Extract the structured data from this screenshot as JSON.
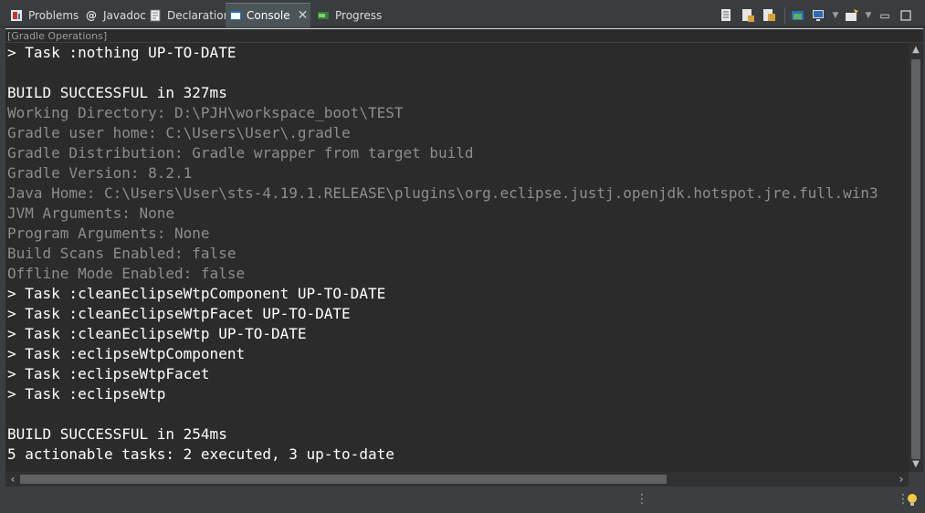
{
  "tabs": [
    {
      "label": "Problems",
      "icon": "problems-icon",
      "active": false
    },
    {
      "label": "Javadoc",
      "icon": "javadoc-icon",
      "active": false
    },
    {
      "label": "Declaration",
      "icon": "declaration-icon",
      "active": false
    },
    {
      "label": "Console",
      "icon": "console-icon",
      "active": true
    },
    {
      "label": "Progress",
      "icon": "progress-icon",
      "active": false
    }
  ],
  "console": {
    "name": "[Gradle Operations]",
    "lines": [
      {
        "text": "> Task :nothing UP-TO-DATE",
        "dim": false
      },
      {
        "text": "",
        "dim": false
      },
      {
        "text": "BUILD SUCCESSFUL in 327ms",
        "dim": false
      },
      {
        "text": "Working Directory: D:\\PJH\\workspace_boot\\TEST",
        "dim": true
      },
      {
        "text": "Gradle user home: C:\\Users\\User\\.gradle",
        "dim": true
      },
      {
        "text": "Gradle Distribution: Gradle wrapper from target build",
        "dim": true
      },
      {
        "text": "Gradle Version: 8.2.1",
        "dim": true
      },
      {
        "text": "Java Home: C:\\Users\\User\\sts-4.19.1.RELEASE\\plugins\\org.eclipse.justj.openjdk.hotspot.jre.full.win3",
        "dim": true
      },
      {
        "text": "JVM Arguments: None",
        "dim": true
      },
      {
        "text": "Program Arguments: None",
        "dim": true
      },
      {
        "text": "Build Scans Enabled: false",
        "dim": true
      },
      {
        "text": "Offline Mode Enabled: false",
        "dim": true
      },
      {
        "text": "> Task :cleanEclipseWtpComponent UP-TO-DATE",
        "dim": false
      },
      {
        "text": "> Task :cleanEclipseWtpFacet UP-TO-DATE",
        "dim": false
      },
      {
        "text": "> Task :cleanEclipseWtp UP-TO-DATE",
        "dim": false
      },
      {
        "text": "> Task :eclipseWtpComponent",
        "dim": false
      },
      {
        "text": "> Task :eclipseWtpFacet",
        "dim": false
      },
      {
        "text": "> Task :eclipseWtp",
        "dim": false
      },
      {
        "text": "",
        "dim": false
      },
      {
        "text": "BUILD SUCCESSFUL in 254ms",
        "dim": false
      },
      {
        "text": "5 actionable tasks: 2 executed, 3 up-to-date",
        "dim": false
      }
    ]
  },
  "colors": {
    "background": "#2b2b2b",
    "text": "#ffffff",
    "dim_text": "#8d8d8d",
    "tab_active": "#4b5457"
  }
}
